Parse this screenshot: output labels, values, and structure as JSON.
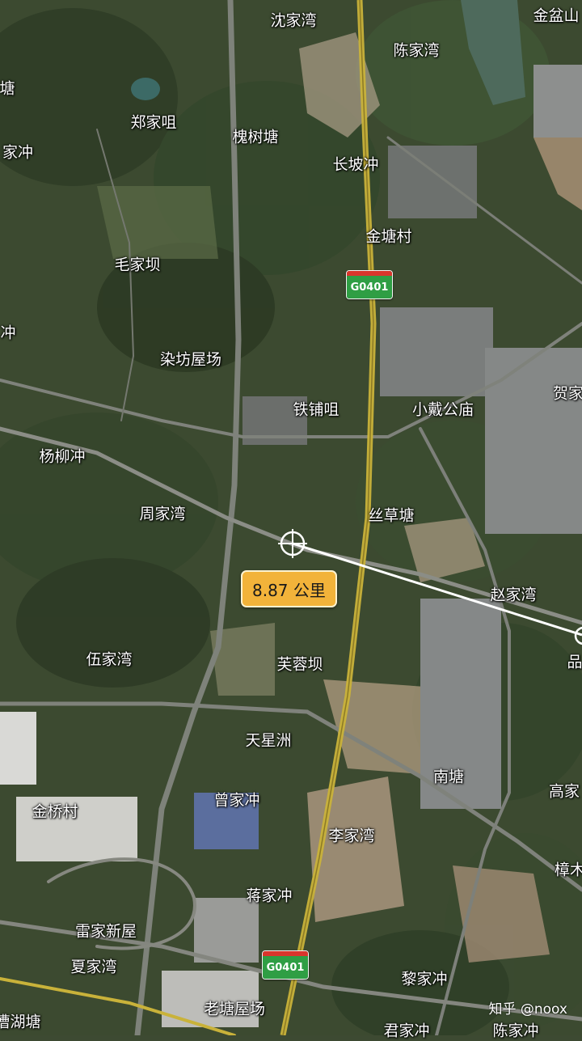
{
  "map": {
    "places": [
      {
        "id": "shenjiawan",
        "label": "沈家湾"
      },
      {
        "id": "jinpenshan",
        "label": "金盆山"
      },
      {
        "id": "chenjiawan-n",
        "label": "陈家湾"
      },
      {
        "id": "tang-left",
        "label": "塘"
      },
      {
        "id": "zhengjiaju",
        "label": "郑家咀"
      },
      {
        "id": "huaishutang",
        "label": "槐树塘"
      },
      {
        "id": "jiachong-left",
        "label": "家冲"
      },
      {
        "id": "changpochong",
        "label": "长坡冲"
      },
      {
        "id": "jintangcun",
        "label": "金塘村"
      },
      {
        "id": "maojiaba",
        "label": "毛家坝"
      },
      {
        "id": "chong-left",
        "label": "冲"
      },
      {
        "id": "ranfangwuchang",
        "label": "染坊屋场"
      },
      {
        "id": "tiepuju",
        "label": "铁铺咀"
      },
      {
        "id": "xiaodaigongmiao",
        "label": "小戴公庙"
      },
      {
        "id": "hejia-right",
        "label": "贺家"
      },
      {
        "id": "yangliuchong",
        "label": "杨柳冲"
      },
      {
        "id": "zhoujiawan",
        "label": "周家湾"
      },
      {
        "id": "sicaotang",
        "label": "丝草塘"
      },
      {
        "id": "zhaojiawan",
        "label": "赵家湾"
      },
      {
        "id": "wujiawan",
        "label": "伍家湾"
      },
      {
        "id": "furongba",
        "label": "芙蓉坝"
      },
      {
        "id": "pin-right",
        "label": "品"
      },
      {
        "id": "tianxingzhou",
        "label": "天星洲"
      },
      {
        "id": "nantang",
        "label": "南塘"
      },
      {
        "id": "gaojia-right",
        "label": "高家"
      },
      {
        "id": "jinqiaocun",
        "label": "金桥村"
      },
      {
        "id": "zengjiachong",
        "label": "曾家冲"
      },
      {
        "id": "lijiawan",
        "label": "李家湾"
      },
      {
        "id": "zhangmu-right",
        "label": "樟木"
      },
      {
        "id": "jiangjiachong",
        "label": "蒋家冲"
      },
      {
        "id": "leijiaxinwu",
        "label": "雷家新屋"
      },
      {
        "id": "xiajiawan",
        "label": "夏家湾"
      },
      {
        "id": "lijiachong",
        "label": "黎家冲"
      },
      {
        "id": "caohutang",
        "label": "漕湖塘"
      },
      {
        "id": "laotangwuchang",
        "label": "老塘屋场"
      },
      {
        "id": "junjiachong",
        "label": "君家冲"
      },
      {
        "id": "chenjiachong",
        "label": "陈家冲"
      }
    ],
    "road_shield_label": "G0401",
    "measurement": {
      "distance_label": "8.87 公里"
    },
    "watermark": "知乎 @noox",
    "colors": {
      "badge": "#f2b33a",
      "expressway": "#c9b23a",
      "measure_line": "#ffffff",
      "shield_green": "#2f9e44",
      "shield_red": "#d9352c"
    }
  }
}
